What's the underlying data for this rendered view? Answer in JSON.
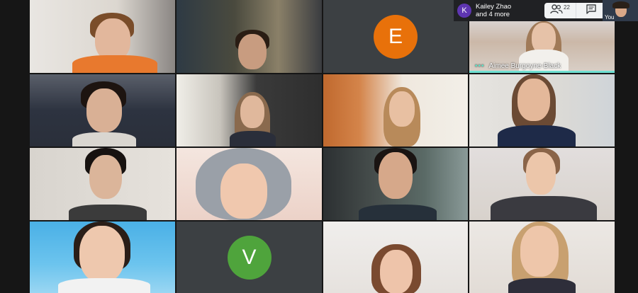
{
  "header": {
    "participant_initial": "K",
    "participant_names_line1": "Kailey Zhao",
    "participant_names_line2": "and 4 more",
    "people_count": "22",
    "self_label": "You"
  },
  "tiles": {
    "row1_col3_initial": "E",
    "row4_col2_initial": "V",
    "active_speaker_name": "Aimee Burgoyne-Black"
  },
  "colors": {
    "background": "#161616",
    "avatar_E": "#e8710a",
    "avatar_V": "#4fa43c",
    "avatar_K": "#5e35b1",
    "speaking_indicator": "#6fe0d2"
  },
  "icons": {
    "people": "people-icon",
    "chat": "chat-icon",
    "audio": "audio-level-icon"
  }
}
